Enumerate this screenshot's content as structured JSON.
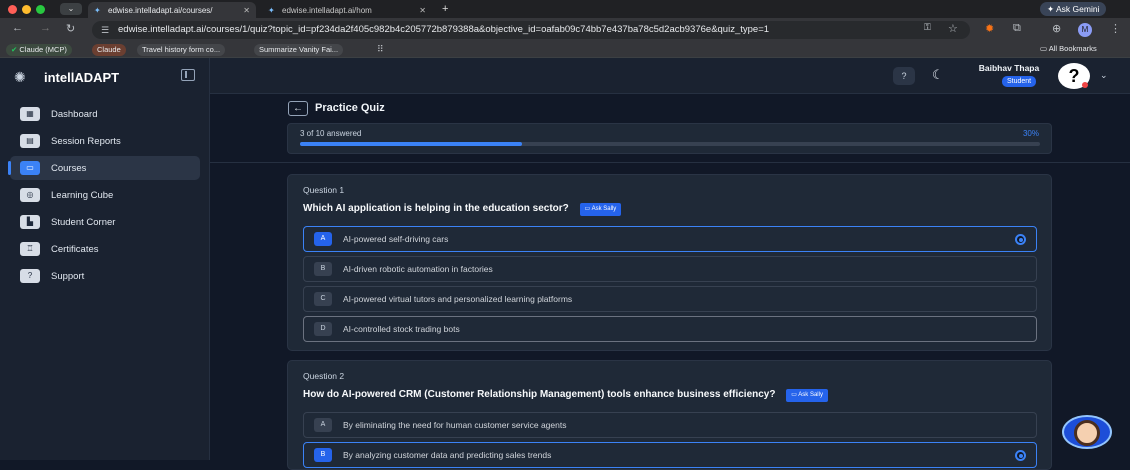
{
  "browser": {
    "tabs": [
      {
        "label": "edwise.intelladapt.ai/courses/"
      },
      {
        "label": "edwise.intelladapt.ai/hom"
      }
    ],
    "new_tab": "+",
    "ask_gemini": "Ask Gemini",
    "url": "edwise.intelladapt.ai/courses/1/quiz?topic_id=pf234da2f405c982b4c205772b879388a&objective_id=oafab09c74bb7e437ba78c5d2acb9376e&quiz_type=1",
    "bookmarks": [
      "Claude (MCP)",
      "Claude",
      "Travel history form co...",
      "Summarize Vanity Fai..."
    ],
    "all_bookmarks": "All Bookmarks"
  },
  "app": {
    "brand": "intellADAPT",
    "nav": [
      {
        "label": "Dashboard",
        "icon": "dashboard-icon"
      },
      {
        "label": "Session Reports",
        "icon": "reports-icon"
      },
      {
        "label": "Courses",
        "icon": "courses-icon"
      },
      {
        "label": "Learning Cube",
        "icon": "cube-icon"
      },
      {
        "label": "Student Corner",
        "icon": "chart-icon"
      },
      {
        "label": "Certificates",
        "icon": "certificate-icon"
      },
      {
        "label": "Support",
        "icon": "support-icon"
      }
    ],
    "active_nav": "Courses",
    "user": {
      "name": "Baibhav Thapa",
      "role": "Student"
    }
  },
  "quiz": {
    "title": "Practice Quiz",
    "progress_text": "3 of 10 answered",
    "progress_percent_label": "30%",
    "progress_fraction": 0.3,
    "ask_label": "Ask Sally",
    "questions": [
      {
        "number": "Question 1",
        "text": "Which AI application is helping in the education sector?",
        "options": [
          {
            "letter": "A",
            "text": "AI-powered self-driving cars",
            "selected": true
          },
          {
            "letter": "B",
            "text": "AI-driven robotic automation in factories",
            "selected": false
          },
          {
            "letter": "C",
            "text": "AI-powered virtual tutors and personalized learning platforms",
            "selected": false
          },
          {
            "letter": "D",
            "text": "AI-controlled stock trading bots",
            "selected": false
          }
        ]
      },
      {
        "number": "Question 2",
        "text": "How do AI-powered CRM (Customer Relationship Management) tools enhance business efficiency?",
        "options": [
          {
            "letter": "A",
            "text": "By eliminating the need for human customer service agents",
            "selected": false
          },
          {
            "letter": "B",
            "text": "By analyzing customer data and predicting sales trends",
            "selected": true
          }
        ]
      }
    ]
  }
}
